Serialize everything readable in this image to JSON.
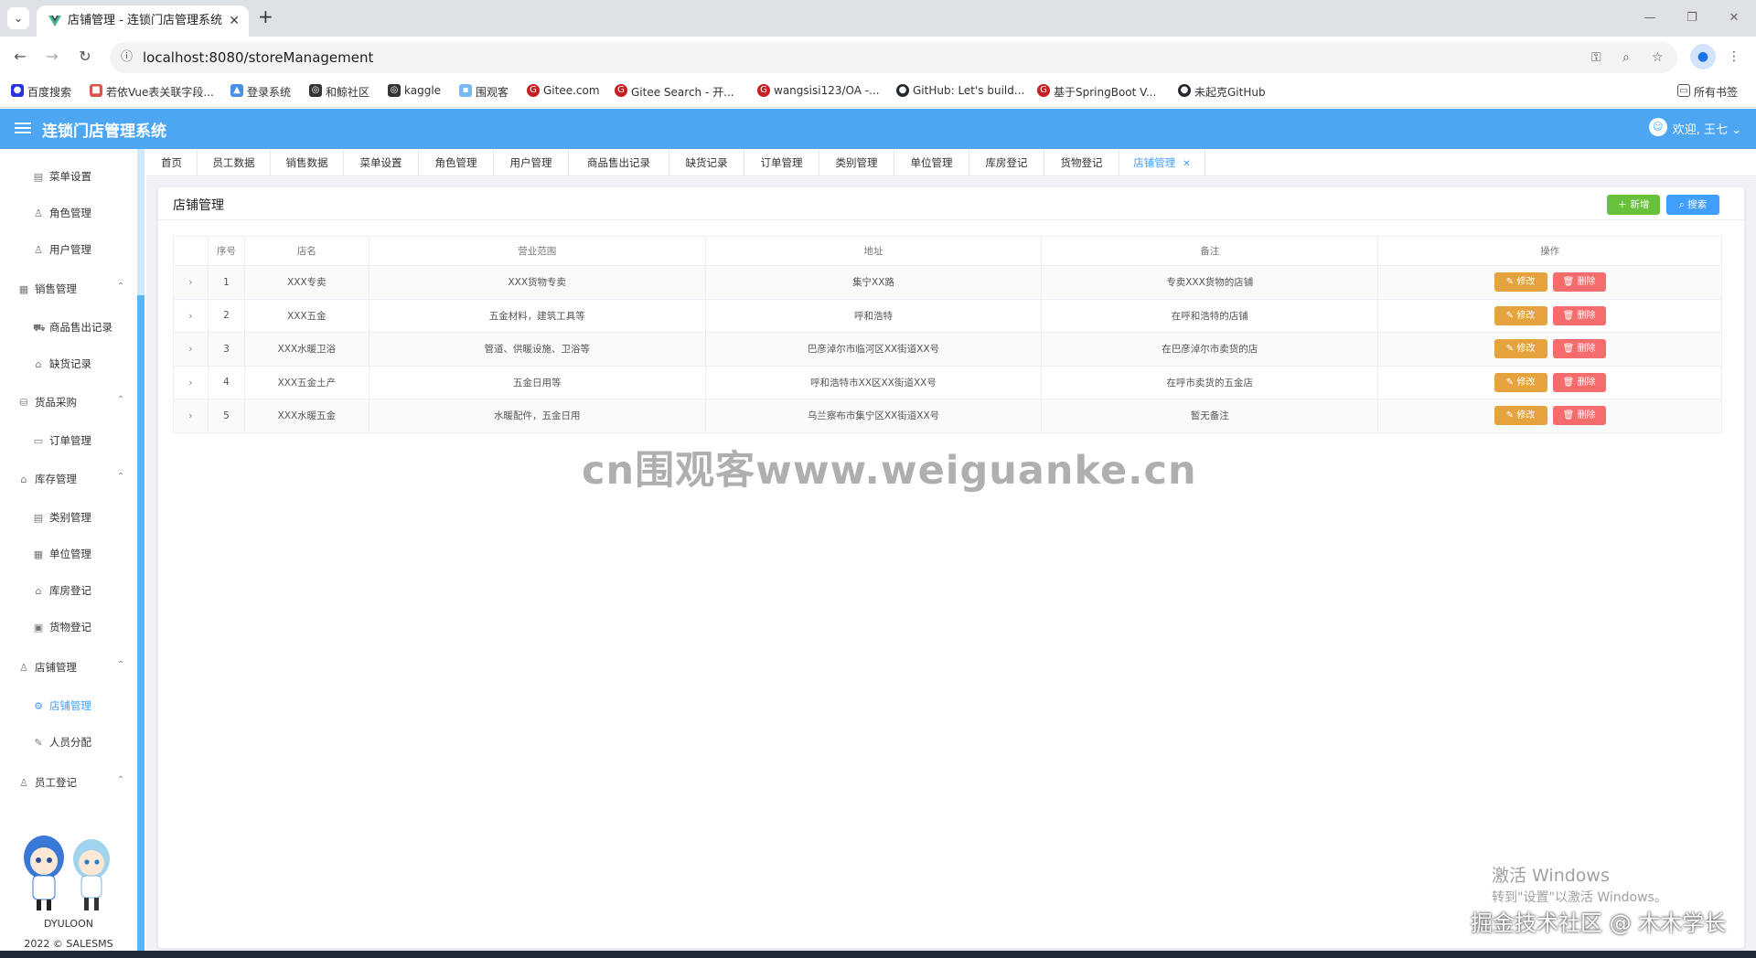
{
  "browser": {
    "tab_title": "店铺管理 - 连锁门店管理系统",
    "url": "localhost:8080/storeManagement",
    "bookmarks": [
      {
        "label": "百度搜索",
        "color": "#2932e1"
      },
      {
        "label": "若依Vue表关联字段...",
        "color": "#d9534f"
      },
      {
        "label": "登录系统",
        "color": "#4a90e2"
      },
      {
        "label": "和鲸社区",
        "color": "#333333"
      },
      {
        "label": "kaggle",
        "color": "#333333"
      },
      {
        "label": "围观客",
        "color": "#7ab8f5"
      },
      {
        "label": "Gitee.com",
        "color": "#c71d23"
      },
      {
        "label": "Gitee Search - 开...",
        "color": "#c71d23"
      },
      {
        "label": "wangsisi123/OA -...",
        "color": "#c71d23"
      },
      {
        "label": "GitHub: Let's build...",
        "color": "#24292f"
      },
      {
        "label": "基于SpringBoot V...",
        "color": "#c71d23"
      },
      {
        "label": "未起克GitHub",
        "color": "#24292f"
      }
    ],
    "all_bookmarks": "所有书签"
  },
  "app": {
    "title": "连锁门店管理系统",
    "greeting": "欢迎, 王七",
    "accent": "#409eff",
    "header_color": "#4da6f2"
  },
  "sidebar": {
    "items": [
      {
        "label": "菜单设置",
        "icon": "document-icon",
        "type": "item"
      },
      {
        "label": "角色管理",
        "icon": "user-icon",
        "type": "item"
      },
      {
        "label": "用户管理",
        "icon": "user-icon",
        "type": "item"
      },
      {
        "label": "销售管理",
        "icon": "chart-icon",
        "type": "group"
      },
      {
        "label": "商品售出记录",
        "icon": "truck-icon",
        "type": "item"
      },
      {
        "label": "缺货记录",
        "icon": "bag-icon",
        "type": "item"
      },
      {
        "label": "货品采购",
        "icon": "cart-icon",
        "type": "group"
      },
      {
        "label": "订单管理",
        "icon": "tickets-icon",
        "type": "item"
      },
      {
        "label": "库存管理",
        "icon": "warehouse-icon",
        "type": "group"
      },
      {
        "label": "类别管理",
        "icon": "document-icon",
        "type": "item"
      },
      {
        "label": "单位管理",
        "icon": "office-icon",
        "type": "item"
      },
      {
        "label": "库房登记",
        "icon": "house-icon",
        "type": "item"
      },
      {
        "label": "货物登记",
        "icon": "box-icon",
        "type": "item"
      },
      {
        "label": "店铺管理",
        "icon": "user-icon",
        "type": "group"
      },
      {
        "label": "店铺管理",
        "icon": "setting-icon",
        "type": "item",
        "active": true
      },
      {
        "label": "人员分配",
        "icon": "edit-icon",
        "type": "item"
      },
      {
        "label": "员工登记",
        "icon": "user-icon",
        "type": "group"
      }
    ],
    "brand": "DYULOON",
    "copyright": "2022 © SALESMS"
  },
  "route_tabs": [
    "首页",
    "员工数据",
    "销售数据",
    "菜单设置",
    "角色管理",
    "用户管理",
    "商品售出记录",
    "缺货记录",
    "订单管理",
    "类别管理",
    "单位管理",
    "库房登记",
    "货物登记",
    "店铺管理"
  ],
  "card": {
    "title": "店铺管理",
    "add_label": "新增",
    "search_label": "搜索"
  },
  "table": {
    "columns": [
      "",
      "序号",
      "店名",
      "营业范围",
      "地址",
      "备注",
      "操作"
    ],
    "edit_label": "修改",
    "delete_label": "删除",
    "rows": [
      {
        "no": "1",
        "name": "XXX专卖",
        "scope": "XXX货物专卖",
        "address": "集宁XX路",
        "remark": "专卖XXX货物的店铺"
      },
      {
        "no": "2",
        "name": "XXX五金",
        "scope": "五金材料，建筑工具等",
        "address": "呼和浩特",
        "remark": "在呼和浩特的店铺"
      },
      {
        "no": "3",
        "name": "XXX水暖卫浴",
        "scope": "管道、供暖设施、卫浴等",
        "address": "巴彦淖尔市临河区XX街道XX号",
        "remark": "在巴彦淖尔市卖货的店"
      },
      {
        "no": "4",
        "name": "XXX五金土产",
        "scope": "五金日用等",
        "address": "呼和浩特市XX区XX街道XX号",
        "remark": "在呼市卖货的五金店"
      },
      {
        "no": "5",
        "name": "XXX水暖五金",
        "scope": "水暖配件，五金日用",
        "address": "乌兰察布市集宁区XX街道XX号",
        "remark": "暂无备注"
      }
    ]
  },
  "overlays": {
    "watermark": "cn围观客www.weiguanke.cn",
    "windows_activate": "激活 Windows",
    "windows_activate_hint": "转到\"设置\"以激活 Windows。",
    "juejin": "掘金技术社区 @ 木木学长"
  }
}
